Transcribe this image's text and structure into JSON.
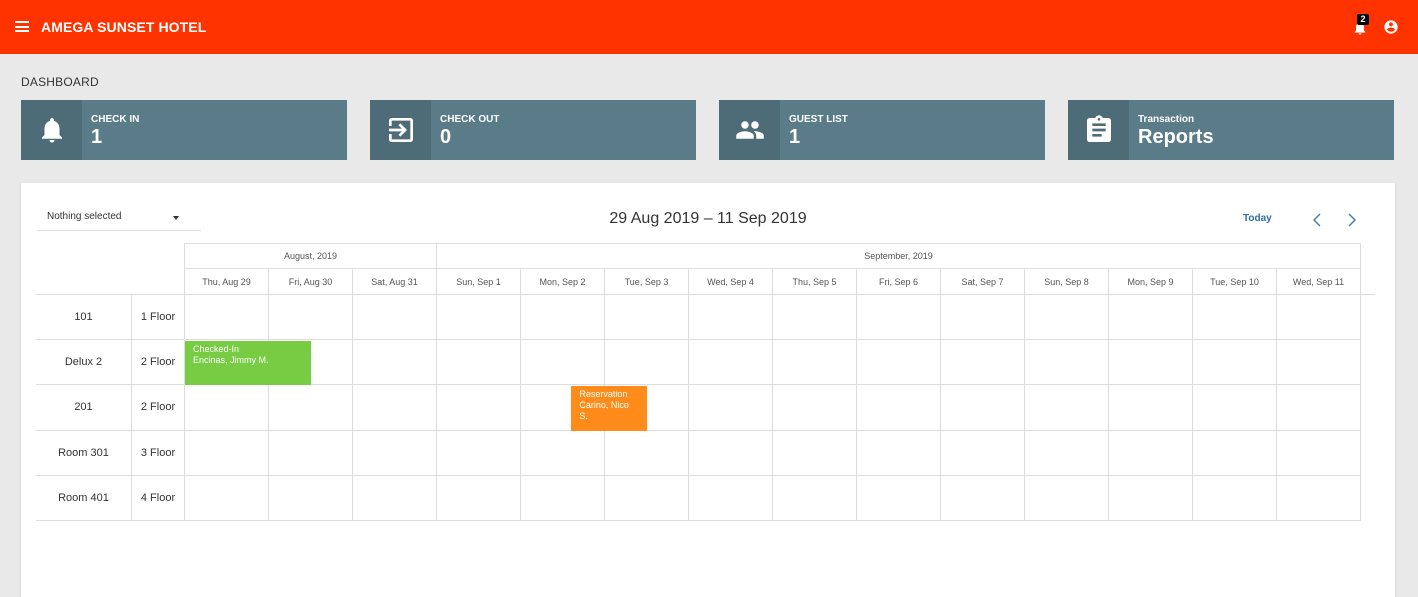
{
  "app": {
    "title": "AMEGA SUNSET HOTEL",
    "notification_count": "2"
  },
  "page": {
    "title": "DASHBOARD"
  },
  "cards": [
    {
      "label": "CHECK IN",
      "value": "1",
      "icon": "bell-icon"
    },
    {
      "label": "CHECK OUT",
      "value": "0",
      "icon": "exit-icon"
    },
    {
      "label": "GUEST LIST",
      "value": "1",
      "icon": "people-icon"
    },
    {
      "label": "Transaction",
      "value": "Reports",
      "icon": "clipboard-icon"
    }
  ],
  "scheduler": {
    "filter_placeholder": "Nothing selected",
    "range_title": "29 Aug 2019 – 11 Sep 2019",
    "today_label": "Today",
    "months": [
      "August, 2019",
      "September, 2019"
    ],
    "days": [
      "Thu, Aug 29",
      "Fri, Aug 30",
      "Sat, Aug 31",
      "Sun, Sep 1",
      "Mon, Sep 2",
      "Tue, Sep 3",
      "Wed, Sep 4",
      "Thu, Sep 5",
      "Fri, Sep 6",
      "Sat, Sep 7",
      "Sun, Sep 8",
      "Mon, Sep 9",
      "Tue, Sep 10",
      "Wed, Sep 11"
    ],
    "rooms": [
      {
        "name": "101",
        "floor": "1 Floor"
      },
      {
        "name": "Delux 2",
        "floor": "2 Floor"
      },
      {
        "name": "201",
        "floor": "2 Floor"
      },
      {
        "name": "Room 301",
        "floor": "3 Floor"
      },
      {
        "name": "Room 401",
        "floor": "4 Floor"
      }
    ],
    "events": [
      {
        "status": "Checked-In",
        "guest": "Encinas, Jimmy M.",
        "color": "#77cc44"
      },
      {
        "status": "Reservation",
        "guest": "Carino, Nico S.",
        "color": "#ff8c1a"
      }
    ]
  }
}
